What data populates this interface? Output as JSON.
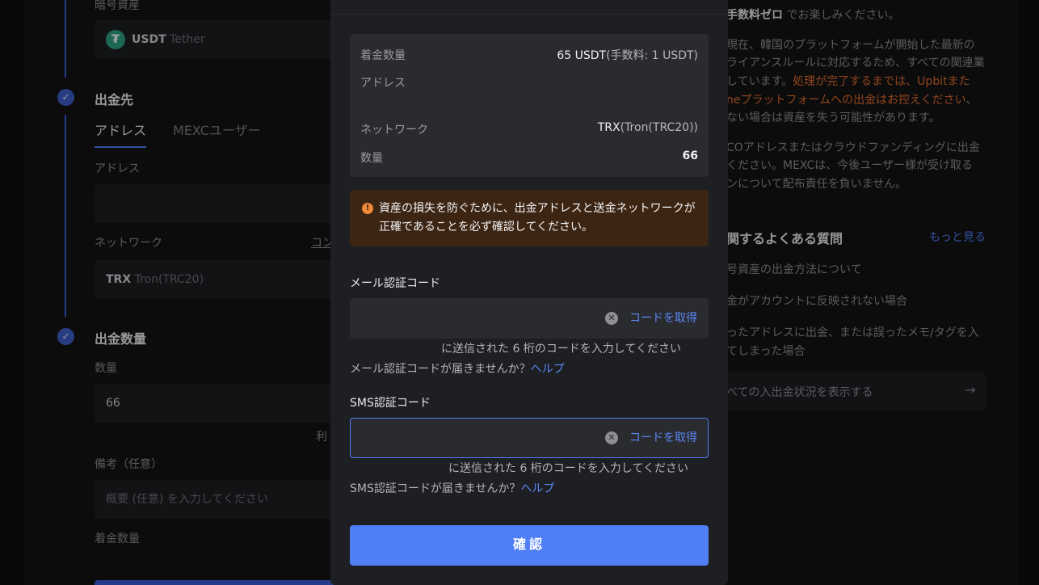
{
  "background": {
    "asset_section_label": "暗号資産",
    "asset": {
      "symbol": "USDT",
      "name": "Tether",
      "icon": "tether-icon"
    },
    "destination_title": "出金先",
    "tabs": [
      {
        "label": "アドレス",
        "active": true
      },
      {
        "label": "MEXCユーザー",
        "active": false
      }
    ],
    "address_label": "アドレス",
    "network_label": "ネットワーク",
    "network_right_cut": "コン",
    "network": {
      "symbol": "TRX",
      "name": "Tron(TRC20)"
    },
    "amount_title": "出金数量",
    "quantity_label": "数量",
    "quantity_value": "66",
    "available_cut": "利",
    "memo_label": "備考（任意）",
    "memo_placeholder": "概要 (任意) を入力してください",
    "arrival_label": "着金数量",
    "right_panel": {
      "lines": [
        {
          "prefix": "手数料ゼロ",
          "text": " でお楽しみください。"
        },
        {
          "text": "現在、韓国のプラットフォームが開始した最新の"
        },
        {
          "text": "ライアンスルールに対応するため、すべての関連業"
        },
        {
          "text": "しています。",
          "orange": "処理が完了するまでは、Upbitまた"
        },
        {
          "orange": "neプラットフォームへの出金はお控えください",
          "text": "、"
        },
        {
          "text": "ない場合は資産を失う可能性があります。"
        },
        {
          "text": "COアドレスまたはクラウドファンディングに出金"
        },
        {
          "text": "ください。MEXCは、今後ユーザー様が受け取る"
        },
        {
          "text": "ンについて配布責任を負いません。"
        }
      ],
      "faq_title": "関するよくある質問",
      "faq_more": "もっと見る",
      "faq_items": [
        "号資産の出金方法について",
        "金がアカウントに反映されない場合",
        "ったアドレスに出金、または誤ったメモ/タグを入",
        "てしまった場合"
      ],
      "status_link": "べての入出金状況を表示する",
      "status_arrow": "→"
    }
  },
  "modal": {
    "summary": {
      "arrival_label": "着金数量",
      "arrival_value": "65 USDT",
      "arrival_fee": "(手数料: 1 USDT)",
      "address_label": "アドレス",
      "address_value": "",
      "network_label": "ネットワーク",
      "network_symbol": "TRX",
      "network_name": "(Tron(TRC20))",
      "quantity_label": "数量",
      "quantity_value": "66"
    },
    "warning": {
      "icon": "warning-icon",
      "text": "資産の損失を防ぐために、出金アドレスと送金ネットワークが正確であることを必ず確認してください。"
    },
    "email": {
      "label": "メール認証コード",
      "value": "",
      "get_code": "コードを取得",
      "hint": "に送信された 6 桁のコードを入力してください",
      "help_question": "メール認証コードが届きませんか？",
      "help_link": "ヘルプ"
    },
    "sms": {
      "label": "SMS認証コード",
      "value": "",
      "get_code": "コードを取得",
      "hint": "に送信された 6 桁のコードを入力してください",
      "help_question": "SMS認証コードが届きませんか？",
      "help_link": "ヘルプ"
    },
    "confirm_label": "確認"
  },
  "colors": {
    "accent": "#4f7ef5",
    "warning_bg": "#3d2514",
    "warning_icon": "#f0893a",
    "step_check": "#3e5ec7",
    "orange_text": "#e06a2e"
  }
}
